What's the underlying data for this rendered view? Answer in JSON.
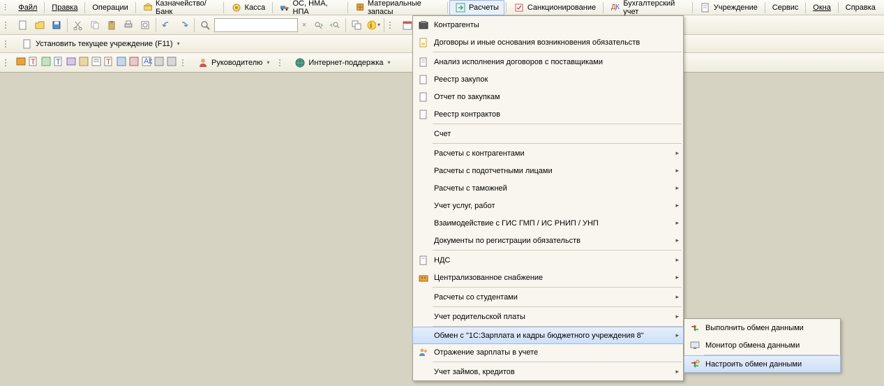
{
  "menu": {
    "file": "Файл",
    "edit": "Правка",
    "ops": "Операции",
    "treasury": "Казначейство/Банк",
    "kassa": "Касса",
    "os": "ОС, НМА, НПА",
    "material": "Материальные запасы",
    "calc": "Расчеты",
    "sanction": "Санкционирование",
    "accounting": "Бухгалтерский учет",
    "institution": "Учреждение",
    "service": "Сервис",
    "windows": "Окна",
    "help": "Справка"
  },
  "tb2": {
    "setinst": "Установить текущее учреждение (F11)"
  },
  "tb3": {
    "manager": "Руководителю",
    "support": "Интернет-поддержка"
  },
  "dd1": [
    "Контрагенты",
    "Договоры и иные основания возникновения обязательств",
    "Анализ исполнения договоров с поставщиками",
    "Реестр закупок",
    "Отчет по закупкам",
    "Реестр контрактов",
    "Счет",
    "Расчеты с контрагентами",
    "Расчеты с подотчетными лицами",
    "Расчеты с таможней",
    "Учет услуг, работ",
    "Взаимодействие с ГИС ГМП / ИС РНИП / УНП",
    "Документы по регистрации обязательств",
    "НДС",
    "Централизованное снабжение",
    "Расчеты со студентами",
    "Учет родительской платы",
    "Обмен с \"1С:Зарплата и кадры бюджетного учреждения 8\"",
    "Отражение зарплаты в учете",
    "Учет займов, кредитов"
  ],
  "dd2": [
    "Выполнить обмен данными",
    "Монитор обмена данными",
    "Настроить обмен данными"
  ]
}
